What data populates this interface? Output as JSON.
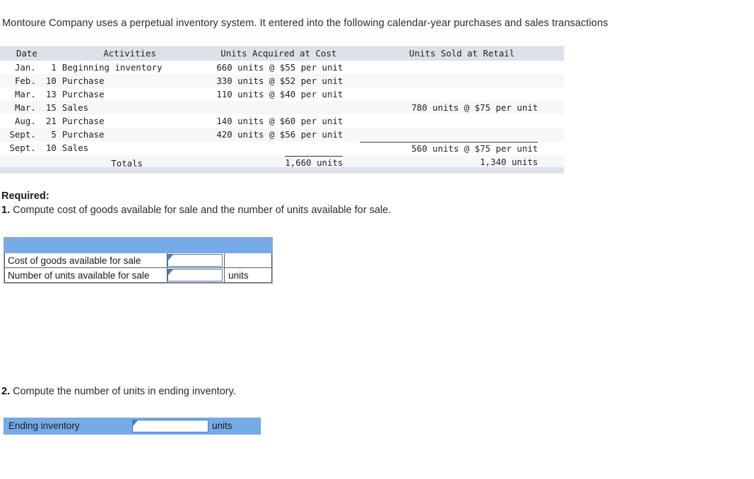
{
  "intro": {
    "text": "Montoure Company uses a perpetual inventory system. It entered into the following calendar-year purchases and sales transactions"
  },
  "transactions_table": {
    "headers": {
      "date": "Date",
      "activities": "Activities",
      "units_acquired": "Units Acquired at Cost",
      "units_sold": "Units Sold at Retail"
    },
    "rows": [
      {
        "month": "Jan.",
        "day": "1",
        "activity": "Beginning inventory",
        "acquired": "660 units @ $55 per unit",
        "sold": ""
      },
      {
        "month": "Feb.",
        "day": "10",
        "activity": "Purchase",
        "acquired": "330 units @ $52 per unit",
        "sold": ""
      },
      {
        "month": "Mar.",
        "day": "13",
        "activity": "Purchase",
        "acquired": "110 units @ $40 per unit",
        "sold": ""
      },
      {
        "month": "Mar.",
        "day": "15",
        "activity": "Sales",
        "acquired": "",
        "sold": "780 units @ $75 per unit"
      },
      {
        "month": "Aug.",
        "day": "21",
        "activity": "Purchase",
        "acquired": "140 units @ $60 per unit",
        "sold": ""
      },
      {
        "month": "Sept.",
        "day": "5",
        "activity": "Purchase",
        "acquired": "420 units @ $56 per unit",
        "sold": ""
      },
      {
        "month": "Sept.",
        "day": "10",
        "activity": "Sales",
        "acquired": "",
        "sold": "560 units @ $75 per unit"
      }
    ],
    "totals": {
      "label": "Totals",
      "acquired": "1,660 units",
      "sold": "1,340 units"
    }
  },
  "required": {
    "heading": "Required:",
    "item1_num": "1.",
    "item1_text": " Compute cost of goods available for sale and the number of units available for sale.",
    "item2_num": "2.",
    "item2_text": " Compute the number of units in ending inventory."
  },
  "answer_form_1": {
    "rows": [
      {
        "label": "Cost of goods available for sale",
        "value": "",
        "unit": ""
      },
      {
        "label": "Number of units available for sale",
        "value": "",
        "unit": "units"
      }
    ]
  },
  "answer_form_2": {
    "label": "Ending inventory",
    "value": "",
    "unit": "units"
  },
  "colors": {
    "accent_blue": "#76abe8",
    "table_header_bg": "#dde2ea",
    "row_stripe": "#f6f7f8",
    "input_border": "#4a7bb5"
  }
}
